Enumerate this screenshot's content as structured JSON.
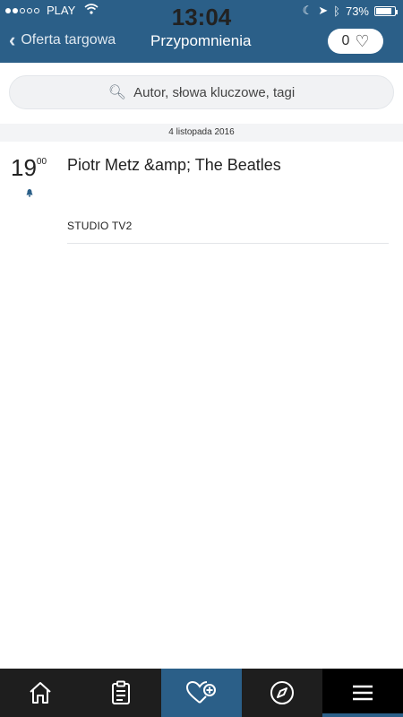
{
  "status": {
    "carrier": "PLAY",
    "time": "13:04",
    "battery": "73%",
    "battery_level": 0.73
  },
  "nav": {
    "back_label": "Oferta targowa",
    "title": "Przypomnienia",
    "favorites_count": "0"
  },
  "search": {
    "placeholder": "Autor, słowa kluczowe, tagi"
  },
  "date_header": "4 listopada 2016",
  "events": [
    {
      "hour": "19",
      "minute": "00",
      "title": "Piotr Metz &amp; The Beatles",
      "location": "STUDIO TV2"
    }
  ],
  "tabs": [
    {
      "icon": "home-icon"
    },
    {
      "icon": "clipboard-icon"
    },
    {
      "icon": "heart-plus-icon",
      "active": true
    },
    {
      "icon": "compass-icon"
    },
    {
      "icon": "menu-icon"
    }
  ],
  "colors": {
    "primary": "#2b5f88",
    "tabbar": "#1e1e1e"
  }
}
